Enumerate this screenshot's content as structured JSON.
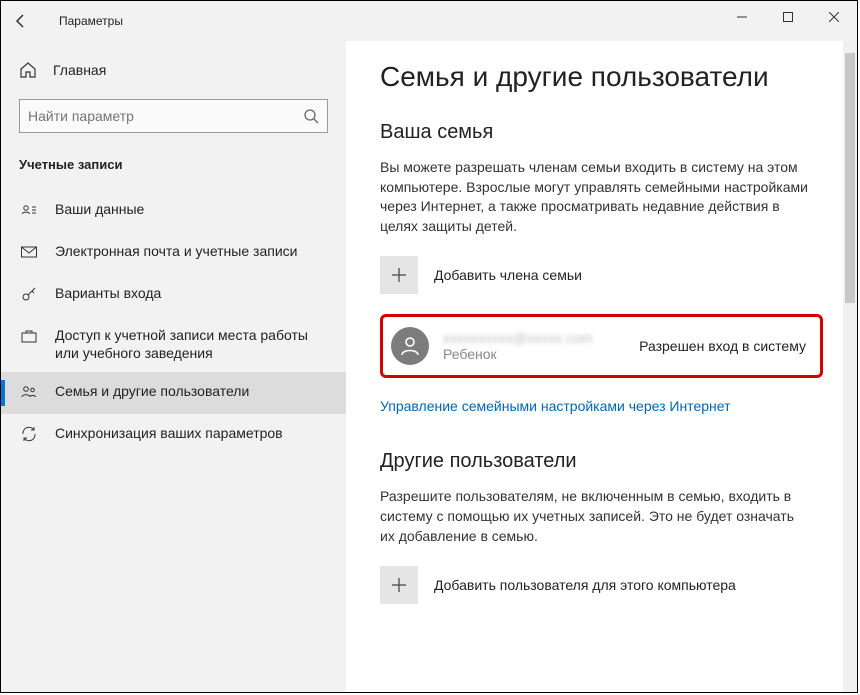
{
  "window": {
    "title": "Параметры"
  },
  "sidebar": {
    "home": "Главная",
    "searchPlaceholder": "Найти параметр",
    "category": "Учетные записи",
    "items": [
      {
        "label": "Ваши данные"
      },
      {
        "label": "Электронная почта и учетные записи"
      },
      {
        "label": "Варианты входа"
      },
      {
        "label": "Доступ к учетной записи места работы или учебного заведения"
      },
      {
        "label": "Семья и другие пользователи"
      },
      {
        "label": "Синхронизация ваших параметров"
      }
    ]
  },
  "page": {
    "title": "Семья и другие пользователи",
    "familySection": "Ваша семья",
    "familyDesc": "Вы можете разрешать членам семьи входить в систему на этом компьютере. Взрослые могут управлять семейными настройками через Интернет, а также просматривать недавние действия в целях защиты детей.",
    "addFamily": "Добавить члена семьи",
    "member": {
      "email": "xxxxxxxxxx@xxxxx.com",
      "role": "Ребенок",
      "status": "Разрешен вход в систему"
    },
    "manageLink": "Управление семейными настройками через Интернет",
    "othersSection": "Другие пользователи",
    "othersDesc": "Разрешите пользователям, не включенным в семью, входить в систему с помощью их учетных записей. Это не будет означать их добавление в семью.",
    "addOther": "Добавить пользователя для этого компьютера"
  }
}
